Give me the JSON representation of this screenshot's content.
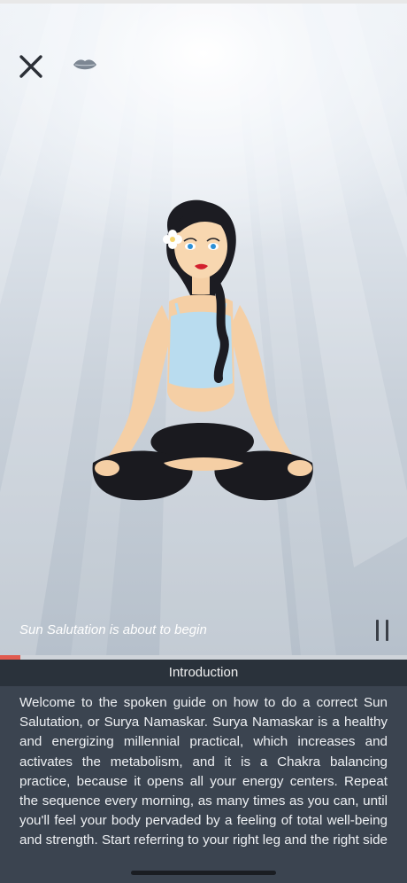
{
  "scene": {
    "close_icon": "close-icon",
    "voice_icon": "lips-icon",
    "illustration": "woman-meditating-lotus-pose",
    "caption": "Sun Salutation is about to begin",
    "pause_icon": "pause-icon"
  },
  "progress": {
    "fraction": 0.05,
    "color": "#e05a4f"
  },
  "section": {
    "title": "Introduction"
  },
  "content": {
    "text": "Welcome to the spoken guide on how to do a correct Sun Salutation, or Surya Namaskar. Surya Namaskar is a healthy and energizing millennial practical, which increases and activates the metabolism, and it is a Chakra balancing practice, because it opens all your energy centers. Repeat the sequence every morning, as many times as you can, until you'll feel your body pervaded by a feeling of total well-being and strength. Start referring to your right leg and the right side of your body, then repeat on the other side."
  },
  "colors": {
    "header_bg": "#2a323b",
    "panel_bg": "#3b4450",
    "accent": "#e05a4f"
  }
}
